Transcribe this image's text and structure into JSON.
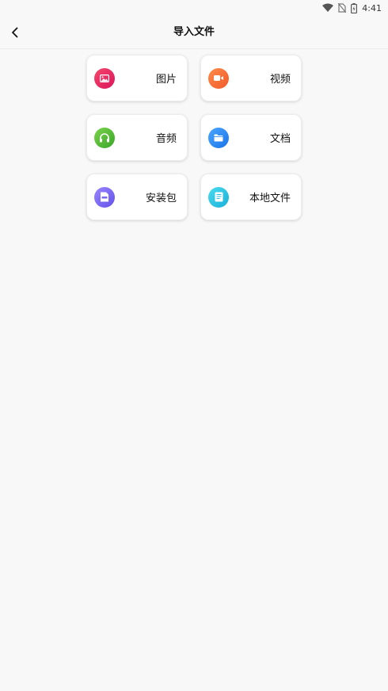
{
  "status_bar": {
    "time": "4:41"
  },
  "app_bar": {
    "title": "导入文件",
    "back_icon": "chevron-left-icon"
  },
  "items": [
    {
      "label": "图片",
      "icon": "image-icon",
      "gradient": [
        "#f5476c",
        "#d9165a"
      ]
    },
    {
      "label": "视频",
      "icon": "video-icon",
      "gradient": [
        "#ff8a4a",
        "#f05a2a"
      ]
    },
    {
      "label": "音频",
      "icon": "headphones-icon",
      "gradient": [
        "#7bd34a",
        "#3aa52a"
      ]
    },
    {
      "label": "文档",
      "icon": "folder-icon",
      "gradient": [
        "#4aa6ff",
        "#1a73e8"
      ]
    },
    {
      "label": "安装包",
      "icon": "apk-icon",
      "gradient": [
        "#9a85ff",
        "#6251e8"
      ]
    },
    {
      "label": "本地文件",
      "icon": "document-icon",
      "gradient": [
        "#48dcf0",
        "#1aaed8"
      ]
    }
  ]
}
